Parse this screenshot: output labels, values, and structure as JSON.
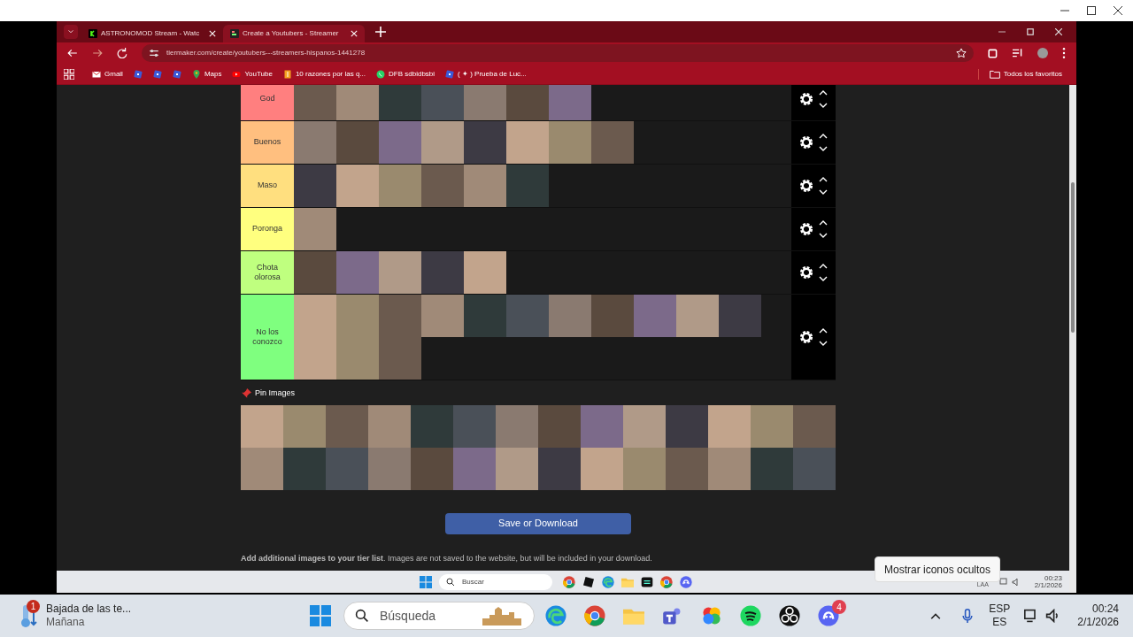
{
  "browser": {
    "tabs": [
      {
        "title": "ASTRONOMOD Stream - Watc",
        "kind": "kick",
        "selected": false
      },
      {
        "title": "Create a Youtubers - Streamer",
        "kind": "tiermaker",
        "selected": true
      }
    ],
    "url": "tiermaker.com/create/youtubers---streamers-hispanos-1441278",
    "bookmarks": [
      {
        "kind": "gmail",
        "label": "Gmail"
      },
      {
        "kind": "roblox"
      },
      {
        "kind": "roblox"
      },
      {
        "kind": "roblox"
      },
      {
        "kind": "maps",
        "label": "Maps"
      },
      {
        "kind": "youtube",
        "label": "YouTube"
      },
      {
        "kind": "page",
        "label": "10 razones por las q..."
      },
      {
        "kind": "whatsapp",
        "label": "DFB sdbidbsbi"
      },
      {
        "kind": "roblox",
        "label": "( ✦ ) Prueba de Luc..."
      }
    ],
    "all_bookmarks": "Todos los favoritos"
  },
  "tiers": [
    {
      "label": "God",
      "color": "#ff7f7f",
      "images": [
        {
          "kind": "photo"
        },
        {
          "kind": "photo"
        },
        {
          "kind": "photo"
        },
        {
          "kind": "photo"
        },
        {
          "kind": "photo"
        },
        {
          "kind": "photo"
        },
        {
          "kind": "photo"
        }
      ]
    },
    {
      "label": "Buenos",
      "color": "#ffbf7f",
      "images": [
        {
          "kind": "photo"
        },
        {
          "kind": "photo"
        },
        {
          "kind": "photo"
        },
        {
          "kind": "photo"
        },
        {
          "kind": "photo"
        },
        {
          "kind": "photo"
        },
        {
          "kind": "photo"
        },
        {
          "kind": "photo"
        }
      ]
    },
    {
      "label": "Maso",
      "color": "#ffdf7f",
      "images": [
        {
          "kind": "photo"
        },
        {
          "kind": "photo"
        },
        {
          "kind": "photo"
        },
        {
          "kind": "photo"
        },
        {
          "kind": "photo"
        },
        {
          "kind": "photo"
        }
      ]
    },
    {
      "label": "Poronga",
      "color": "#ffff7f",
      "images": [
        {
          "kind": "photo"
        }
      ]
    },
    {
      "label": "Chota olorosa",
      "color": "#bfff7f",
      "images": [
        {
          "kind": "photo"
        },
        {
          "kind": "photo"
        },
        {
          "kind": "photo"
        },
        {
          "kind": "photo"
        },
        {
          "kind": "photo"
        }
      ]
    },
    {
      "label": "No los conozco",
      "color": "#7fff7f",
      "images": [
        {
          "kind": "photo"
        },
        {
          "kind": "photo"
        },
        {
          "kind": "photo"
        },
        {
          "kind": "photo"
        },
        {
          "kind": "photo"
        },
        {
          "kind": "photo"
        },
        {
          "kind": "photo"
        },
        {
          "kind": "photo"
        },
        {
          "kind": "photo"
        },
        {
          "kind": "photo"
        },
        {
          "kind": "photo"
        },
        {
          "kind": "photo"
        },
        {
          "kind": "photo"
        },
        {
          "kind": "photo"
        }
      ]
    }
  ],
  "pin_images": {
    "title": "Pin Images",
    "images": [
      {
        "kind": "photo"
      },
      {
        "kind": "photo"
      },
      {
        "kind": "photo"
      },
      {
        "kind": "photo"
      },
      {
        "kind": "photo"
      },
      {
        "kind": "photo"
      },
      {
        "kind": "photo"
      },
      {
        "kind": "photo"
      },
      {
        "kind": "photo"
      },
      {
        "kind": "photo"
      },
      {
        "kind": "photo"
      },
      {
        "kind": "photo"
      },
      {
        "kind": "photo"
      },
      {
        "kind": "photo"
      },
      {
        "kind": "photo"
      },
      {
        "kind": "photo"
      },
      {
        "kind": "photo"
      },
      {
        "kind": "photo"
      },
      {
        "kind": "photo"
      },
      {
        "kind": "photo"
      },
      {
        "kind": "photo"
      },
      {
        "kind": "photo"
      },
      {
        "kind": "photo"
      },
      {
        "kind": "photo"
      },
      {
        "kind": "photo"
      },
      {
        "kind": "photo"
      },
      {
        "kind": "photo"
      },
      {
        "kind": "photo"
      }
    ]
  },
  "save_button": "Save or Download",
  "note": "**Add additional images to your tier list**. Images are not saved to the website, but will be included in your download.",
  "recorded_taskbar": {
    "search_placeholder": "Buscar",
    "apps": [
      {
        "kind": "chrome"
      },
      {
        "kind": "roblox"
      },
      {
        "kind": "edge"
      },
      {
        "kind": "folder"
      },
      {
        "kind": "capcut"
      },
      {
        "kind": "chrome"
      },
      {
        "kind": "discord"
      }
    ],
    "tray_text": "LAA",
    "time": "00:23",
    "date": "2/1/2026"
  },
  "tooltip": "Mostrar iconos ocultos",
  "taskbar": {
    "weather": {
      "badge": "1",
      "title": "Bajada de las te...",
      "subtitle": "Mañana"
    },
    "search_placeholder": "Búsqueda",
    "apps": [
      {
        "kind": "edge"
      },
      {
        "kind": "chrome"
      },
      {
        "kind": "folder"
      },
      {
        "kind": "teams"
      },
      {
        "kind": "photos"
      },
      {
        "kind": "spotify"
      },
      {
        "kind": "obs"
      },
      {
        "kind": "discord",
        "badge": "4"
      }
    ],
    "language": "ESP",
    "layout": "ES",
    "time": "00:24",
    "date": "2/1/2026"
  }
}
